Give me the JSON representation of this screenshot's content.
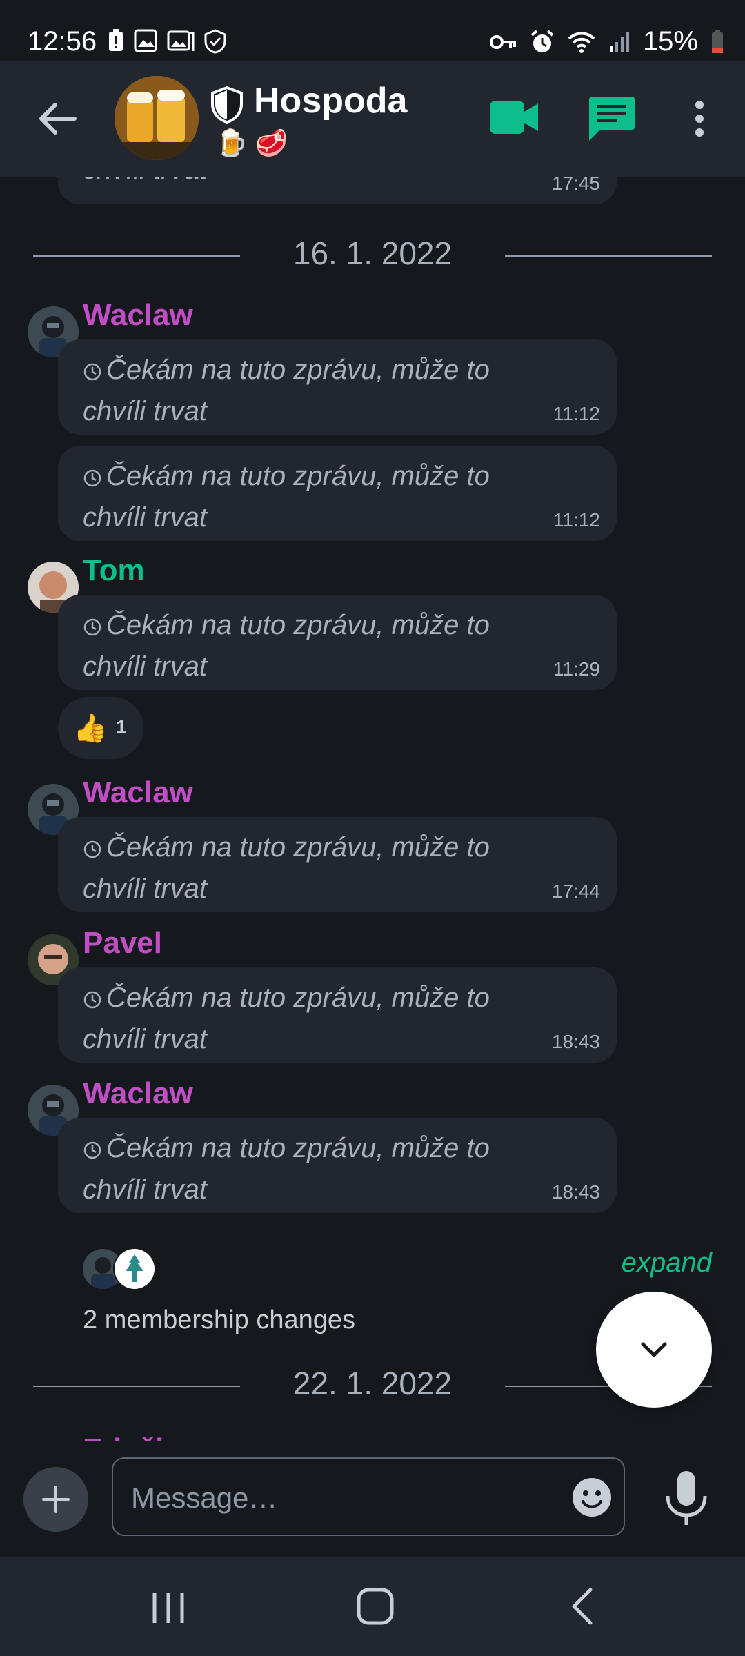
{
  "status_bar": {
    "time": "12:56",
    "battery": "15%",
    "left_icons": [
      "battery-alert-icon",
      "image-icon",
      "gallery-icon",
      "shield-check-icon"
    ],
    "right_icons": [
      "vpn-key-icon",
      "alarm-icon",
      "wifi-icon",
      "signal-icon",
      "battery-icon"
    ]
  },
  "header": {
    "title": "Hospoda",
    "topic": "🍺 🥩",
    "colors": {
      "accent": "#0dbd8b"
    }
  },
  "timeline": {
    "prev_time": "17:45",
    "prev_text_fragment": "chvíli trvat",
    "date_1": "16. 1. 2022",
    "date_2": "22. 1. 2022",
    "waiting_text": "Čekám na tuto zprávu, může to chvíli trvat",
    "groups": [
      {
        "sender": "Waclaw",
        "color": "#c24ec5",
        "times": [
          "11:12",
          "11:12"
        ]
      },
      {
        "sender": "Tom",
        "color": "#0dbd8b",
        "times": [
          "11:29"
        ]
      },
      {
        "sender": "Waclaw",
        "color": "#c24ec5",
        "times": [
          "17:44"
        ]
      },
      {
        "sender": "Pavel",
        "color": "#c24ec5",
        "times": [
          "18:43"
        ]
      },
      {
        "sender": "Waclaw",
        "color": "#c24ec5",
        "times": [
          "18:43"
        ]
      }
    ],
    "reaction": {
      "emoji": "👍",
      "count": "1"
    },
    "membership": {
      "label": "2 membership changes",
      "expand": "expand"
    },
    "next_sender_fragment": "Eduži"
  },
  "composer": {
    "placeholder": "Message…"
  }
}
